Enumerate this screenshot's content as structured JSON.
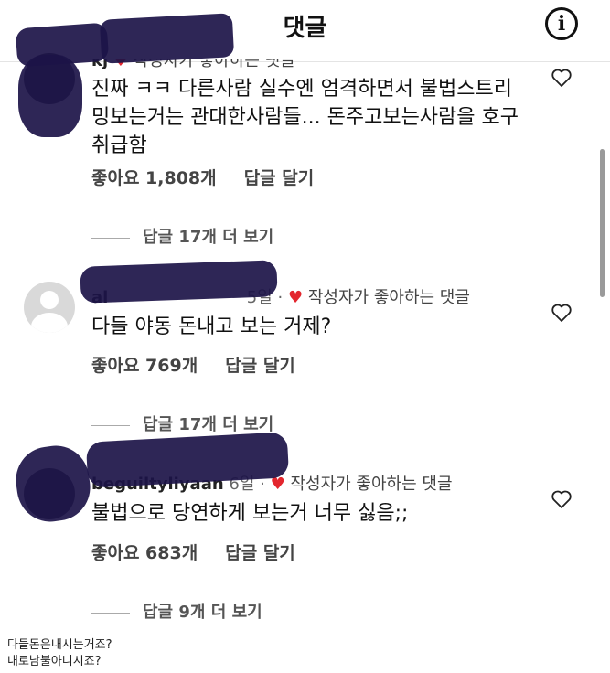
{
  "header": {
    "title": "댓글",
    "info_icon": "info-icon",
    "info_glyph": "i"
  },
  "comments": [
    {
      "username": "kj",
      "meta_time": "",
      "creator_liked": "작성자가 좋아하는 댓글",
      "text": "진짜 ㅋㅋ 다른사람 실수엔 엄격하면서 불법스트리밍보는거는 관대한사람들... 돈주고보는사람을 호구취급함",
      "likes": "좋아요 1,808개",
      "reply": "답글 달기",
      "view_replies": "답글 17개 더 보기"
    },
    {
      "username": "al",
      "meta_time": "5일 ·",
      "creator_liked": "작성자가 좋아하는 댓글",
      "text": "다들 야동 돈내고 보는 거제?",
      "likes": "좋아요 769개",
      "reply": "답글 달기",
      "view_replies": "답글 17개 더 보기"
    },
    {
      "username": "beguiltyliyaan",
      "meta_time": "6일 ·",
      "creator_liked": "작성자가 좋아하는 댓글",
      "text": "불법으로 당연하게 보는거 너무 싫음;;",
      "likes": "좋아요 683개",
      "reply": "답글 달기",
      "view_replies": "답글 9개 더 보기"
    }
  ],
  "caption": {
    "line1": "다들돈은내시는거죠?",
    "line2": "내로남불아니시죠?"
  },
  "colors": {
    "heart": "#e3262e",
    "redaction": "#1c1448"
  }
}
